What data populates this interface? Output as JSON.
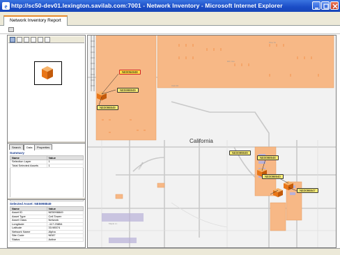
{
  "window": {
    "title": "http://sc50-dev01.lexington.savilab.com:7001 - Network Inventory - Microsoft Internet Explorer",
    "icon": "ie-icon",
    "controls": [
      "minimize-icon",
      "maximize-icon",
      "close-icon"
    ]
  },
  "report_tab": {
    "label": "Network Inventory Report"
  },
  "overview_tools": [
    "select-icon",
    "pan-icon",
    "zoom-in-icon",
    "zoom-out-icon",
    "zoom-extent-icon",
    "refresh-icon"
  ],
  "left_tabs": [
    "Search",
    "Data",
    "Properties"
  ],
  "summary": {
    "title": "Summary",
    "columns": [
      "Name",
      "Value"
    ],
    "rows": [
      [
        "Selection Layer",
        "1"
      ],
      [
        "Total Selected Assets",
        "1"
      ]
    ]
  },
  "selected_asset": {
    "title": "Selected Asset: NE5998849",
    "columns": [
      "Name",
      "Value"
    ],
    "rows": [
      [
        "Asset ID",
        "NE5998849"
      ],
      [
        "Asset Type",
        "Cell Tower"
      ],
      [
        "Asset Class",
        "Network"
      ],
      [
        "Longitude",
        "-117.23854"
      ],
      [
        "Latitude",
        "33.98574"
      ],
      [
        "Network Name",
        "Alpha"
      ],
      [
        "Site Code",
        "NE87"
      ],
      [
        "Status",
        "Active"
      ]
    ]
  },
  "map": {
    "place_name": "California",
    "street_labels": [
      "Oak Rd",
      "Elm Ave",
      "Pine St",
      "Cedar Dr",
      "Maple Ln"
    ],
    "callouts": [
      {
        "text": "NE0054848",
        "style": "red"
      },
      {
        "text": "NE5998849",
        "style": "yel"
      },
      {
        "text": "NE0098849",
        "style": "yel"
      },
      {
        "text": "NE0099849",
        "style": "yel"
      },
      {
        "text": "NE0098948",
        "style": "yel"
      },
      {
        "text": "NE0098940",
        "style": "yel"
      },
      {
        "text": "NE0098847",
        "style": "yel"
      }
    ],
    "colors": {
      "parcel": "#f7b886",
      "parcel_edge": "#e59a5c",
      "road": "#c8c8c8",
      "building": "#b8b0d8",
      "marker": "#f07c1e"
    }
  }
}
